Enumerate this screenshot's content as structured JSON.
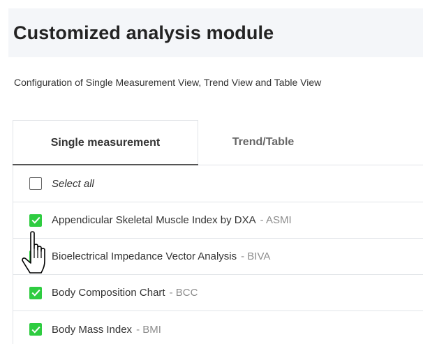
{
  "header": {
    "title": "Customized analysis module"
  },
  "description": "Configuration of Single Measurement View, Trend View and Table View",
  "tabs": [
    {
      "label": "Single measurement",
      "active": true
    },
    {
      "label": "Trend/Table",
      "active": false
    }
  ],
  "select_all": {
    "label": "Select all",
    "checked": false
  },
  "items": [
    {
      "label": "Appendicular Skeletal Muscle Index by DXA",
      "abbr": "- ASMI",
      "checked": true
    },
    {
      "label": "Bioelectrical Impedance Vector Analysis",
      "abbr": "- BIVA",
      "checked": true
    },
    {
      "label": "Body Composition Chart",
      "abbr": "- BCC",
      "checked": true
    },
    {
      "label": "Body Mass Index",
      "abbr": "- BMI",
      "checked": true
    }
  ],
  "colors": {
    "accent_check": "#2ecc40",
    "header_bg": "#f4f6f9"
  },
  "icons": {
    "check": "checkmark-icon",
    "cursor": "hand-pointer-icon"
  }
}
